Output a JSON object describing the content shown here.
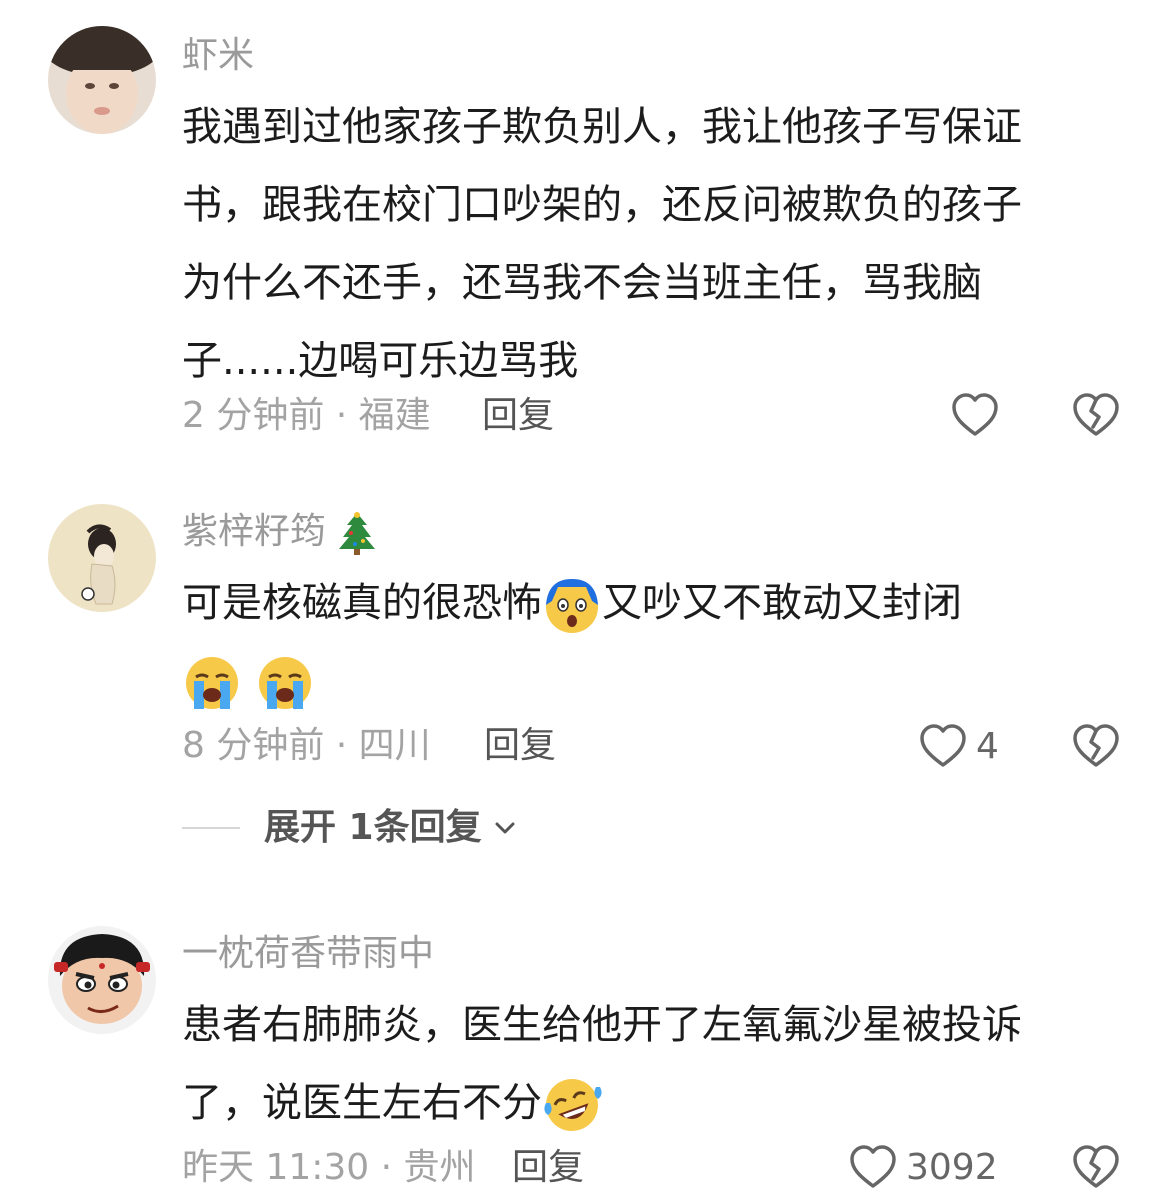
{
  "comments": [
    {
      "username": "虾米",
      "lines": [
        "我遇到过他家孩子欺负别人，我让他孩子写保证",
        "书，跟我在校门口吵架的，还反问被欺负的孩子",
        "为什么不还手，还骂我不会当班主任，骂我脑",
        "子......边喝可乐边骂我"
      ],
      "meta": "2 分钟前 · 福建",
      "reply_label": "回复",
      "like_count": ""
    },
    {
      "username": "紫梓籽筠",
      "badge_icon": "christmas-tree-icon",
      "line1_before": "可是核磁真的很恐怖",
      "line1_emoji": "screaming-face-emoji",
      "line1_after": "又吵又不敢动又封闭",
      "line2_emojis": [
        "loudly-crying-face-emoji",
        "loudly-crying-face-emoji"
      ],
      "meta": "8 分钟前 · 四川",
      "reply_label": "回复",
      "like_count": "4",
      "expand_label": "展开 1条回复"
    },
    {
      "username": "一枕荷香带雨中",
      "lines": [
        "患者右肺肺炎，医生给他开了左氧氟沙星被投诉"
      ],
      "line2_text": "了，说医生左右不分",
      "line2_emoji": "laughing-crying-face-emoji",
      "meta": "昨天 11:30 · 贵州",
      "reply_label": "回复",
      "like_count": "3092"
    }
  ],
  "colors": {
    "secondary_text": "#9a9a9a",
    "primary_text": "#1c1c1c",
    "icon_stroke": "#666666"
  }
}
